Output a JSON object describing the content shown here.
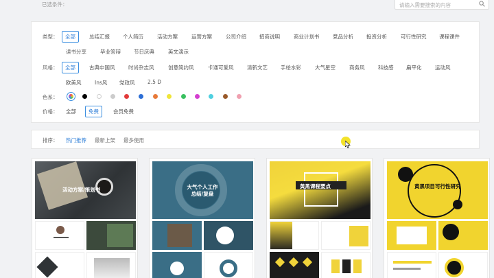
{
  "header": {
    "selected_label": "已选条件：",
    "search_placeholder": "请输入需要搜索的内容"
  },
  "filters": {
    "type": {
      "label": "类型：",
      "items": [
        "全部",
        "总结汇报",
        "个人简历",
        "活动方案",
        "运营方案",
        "公司介绍",
        "招商说明",
        "商业计划书",
        "竞品分析",
        "投资分析",
        "可行性研究",
        "课程课件",
        "读书分享",
        "毕业答辩",
        "节日庆典",
        "英文演示"
      ],
      "selected": "全部"
    },
    "style": {
      "label": "风格：",
      "items": [
        "全部",
        "古典中国风",
        "时尚杂志风",
        "创意简约风",
        "卡通可爱风",
        "清新文艺",
        "手绘水彩",
        "大气星空",
        "商务风",
        "科技感",
        "扁平化",
        "运动风",
        "欧美风",
        "Ins风",
        "党政风",
        "2.5 D"
      ],
      "selected": "全部"
    },
    "color": {
      "label": "色系：",
      "swatches": [
        "#000000",
        "#ffffff",
        "#cccccc",
        "#e23b3b",
        "#2d6fd6",
        "#e87a3a",
        "#f0e53a",
        "#3ac060",
        "#d43fd0",
        "#4fd0e0",
        "#9a5a2a",
        "#f0a0b0"
      ]
    },
    "price": {
      "label": "价格：",
      "items": [
        "全部",
        "免费",
        "会员免费"
      ],
      "selected": "免费"
    }
  },
  "sort": {
    "label": "排序：",
    "items": [
      "热门推荐",
      "最新上架",
      "最多使用"
    ],
    "selected": "热门推荐"
  },
  "cards": [
    {
      "title": "活动方案/策划书"
    },
    {
      "title": "大气个人工作总结/复盘"
    },
    {
      "title": "黄黑课程要点"
    },
    {
      "title": "黄黑项目可行性研究"
    }
  ]
}
